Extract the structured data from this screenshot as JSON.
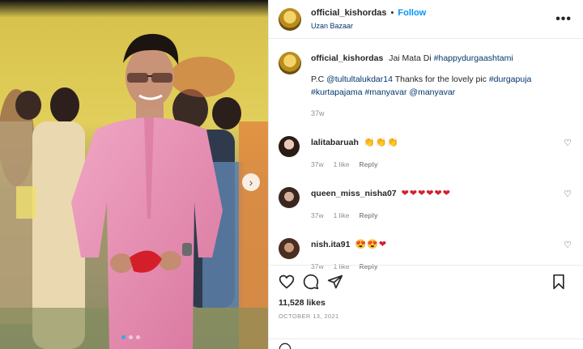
{
  "post": {
    "username": "official_kishordas",
    "follow_label": "Follow",
    "location": "Uzan Bazaar",
    "more_label": "•••",
    "caption_first": "Jai Mata Di",
    "caption_first_tag": "#happydurgaashtami",
    "caption_second_prefix": "P.C",
    "caption_second_mention": "@tultultalukdar14",
    "caption_second_text": "Thanks for the lovely pic",
    "caption_second_tag1": "#durgapuja",
    "caption_second_tag2": "#kurtapajama",
    "caption_second_tag3": "#manyavar",
    "caption_second_mention2": "@manyavar",
    "caption_time": "37w"
  },
  "comments": [
    {
      "username": "lalitabaruah",
      "text": "👏👏👏",
      "time": "37w",
      "likes": "1 like",
      "reply": "Reply"
    },
    {
      "username": "queen_miss_nisha07",
      "text": "❤❤❤❤❤❤",
      "time": "37w",
      "likes": "1 like",
      "reply": "Reply"
    },
    {
      "username": "nish.ita91",
      "text": "😍😍❤",
      "time": "37w",
      "likes": "1 like",
      "reply": "Reply"
    }
  ],
  "actions": {
    "likes_count": "11,528 likes",
    "date": "OCTOBER 13, 2021"
  },
  "icons": {
    "follow_sep": "•",
    "carousel_next": "›",
    "comment_heart": "♡"
  },
  "colors": {
    "link": "#0095f6",
    "hashtag": "#00376b",
    "kurta": "#e58bb0",
    "background_yellow": "#d9c24a"
  }
}
